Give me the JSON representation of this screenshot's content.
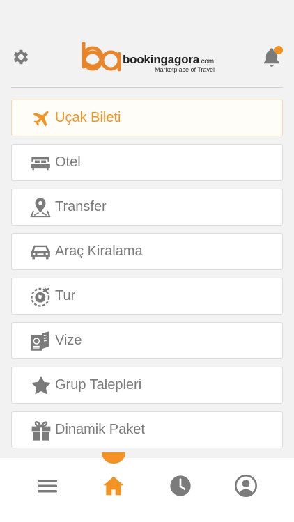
{
  "header": {
    "logo_word": "bookingagora",
    "logo_domain": ".com",
    "logo_tagline": "Marketplace of Travel"
  },
  "menu": [
    {
      "label": "Uçak Bileti",
      "icon": "plane-icon",
      "active": true
    },
    {
      "label": "Otel",
      "icon": "bed-icon",
      "active": false
    },
    {
      "label": "Transfer",
      "icon": "map-pin-icon",
      "active": false
    },
    {
      "label": "Araç Kiralama",
      "icon": "car-icon",
      "active": false
    },
    {
      "label": "Tur",
      "icon": "tour-globe-icon",
      "active": false
    },
    {
      "label": "Vize",
      "icon": "passport-icon",
      "active": false
    },
    {
      "label": "Grup Talepleri",
      "icon": "star-icon",
      "active": false
    },
    {
      "label": "Dinamik Paket",
      "icon": "gift-icon",
      "active": false
    }
  ],
  "tabbar": {
    "tabs": [
      {
        "icon": "hamburger-menu-icon",
        "active": false
      },
      {
        "icon": "home-icon",
        "active": true
      },
      {
        "icon": "clock-icon",
        "active": false
      },
      {
        "icon": "user-icon",
        "active": false
      }
    ]
  },
  "colors": {
    "accent": "#f39323",
    "icon_gray": "#7b7b7b",
    "background": "#f2f2f2"
  }
}
